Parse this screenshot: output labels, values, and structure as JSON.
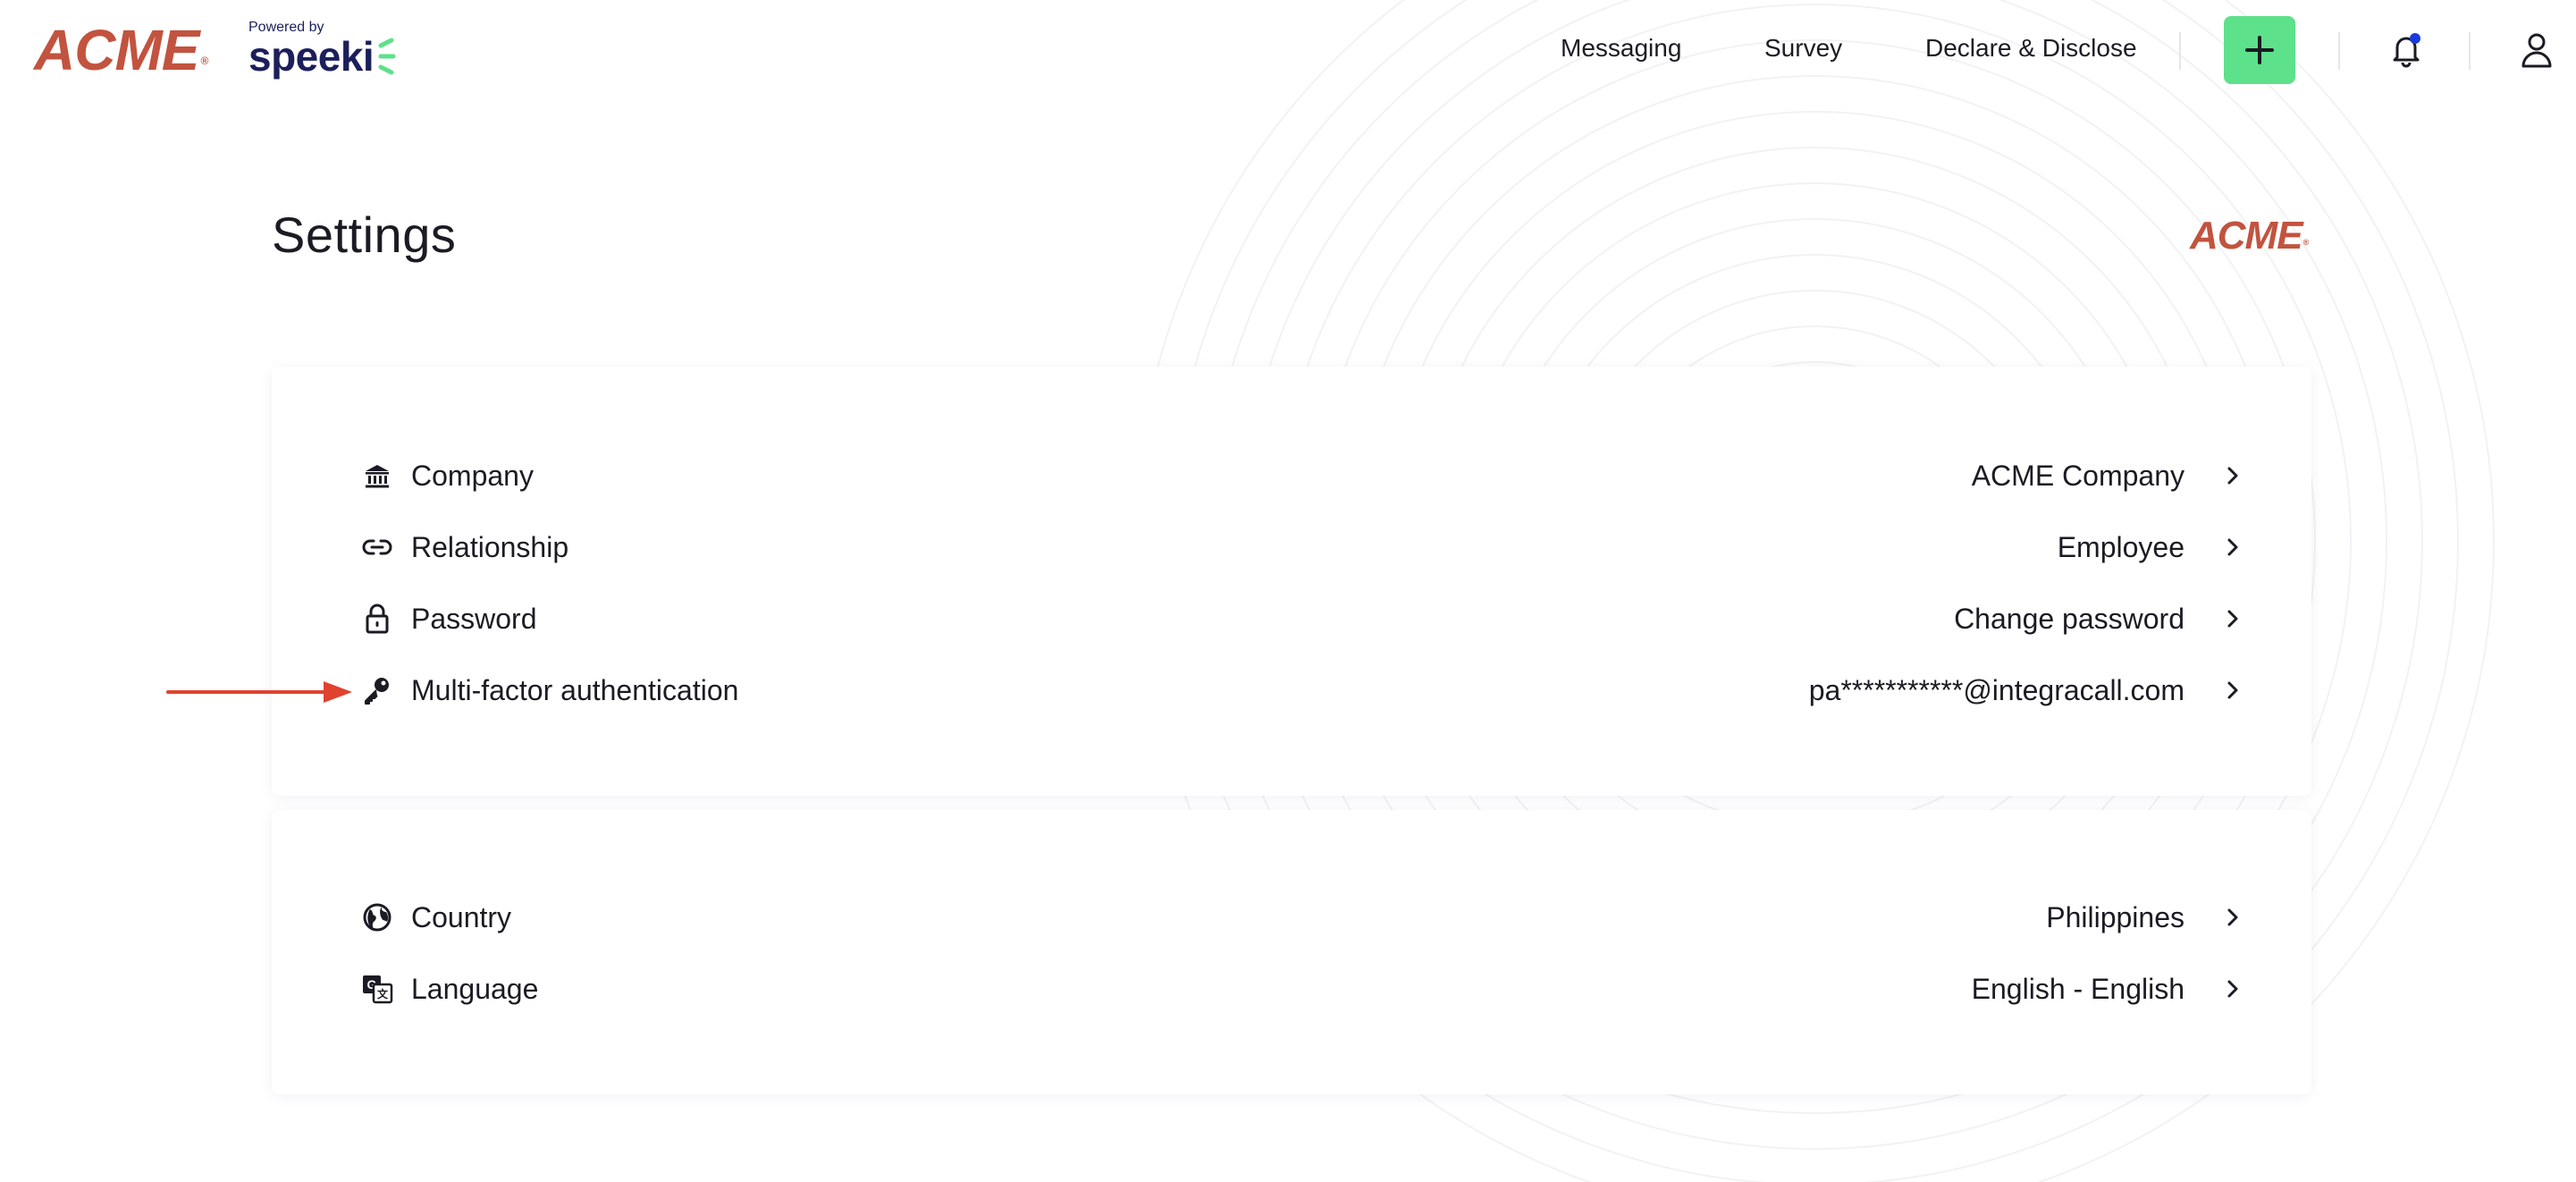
{
  "header": {
    "brand_logo": "ACME",
    "brand_reg": "®",
    "powered_by_label": "Powered by",
    "vendor_name": "speeki",
    "nav": [
      {
        "label": "Messaging"
      },
      {
        "label": "Survey"
      },
      {
        "label": "Declare & Disclose"
      }
    ],
    "add_button_icon": "plus-icon",
    "notification_icon": "bell-icon",
    "notification_badge_color": "#1a3bd8",
    "profile_icon": "user-icon"
  },
  "page": {
    "title": "Settings",
    "company_logo": "ACME",
    "company_logo_reg": "®"
  },
  "settings_groups": [
    {
      "items": [
        {
          "icon": "bank-icon",
          "label": "Company",
          "value": "ACME Company"
        },
        {
          "icon": "link-icon",
          "label": "Relationship",
          "value": "Employee"
        },
        {
          "icon": "lock-icon",
          "label": "Password",
          "value": "Change password"
        },
        {
          "icon": "key-icon",
          "label": "Multi-factor authentication",
          "value": "pa***********@integracall.com"
        }
      ]
    },
    {
      "items": [
        {
          "icon": "globe-icon",
          "label": "Country",
          "value": "Philippines"
        },
        {
          "icon": "translate-icon",
          "label": "Language",
          "value": "English - English"
        }
      ]
    }
  ],
  "colors": {
    "brand_red": "#c2533f",
    "vendor_navy": "#1b1f5b",
    "accent_green": "#5de18a",
    "annotation_arrow": "#e0422f"
  }
}
